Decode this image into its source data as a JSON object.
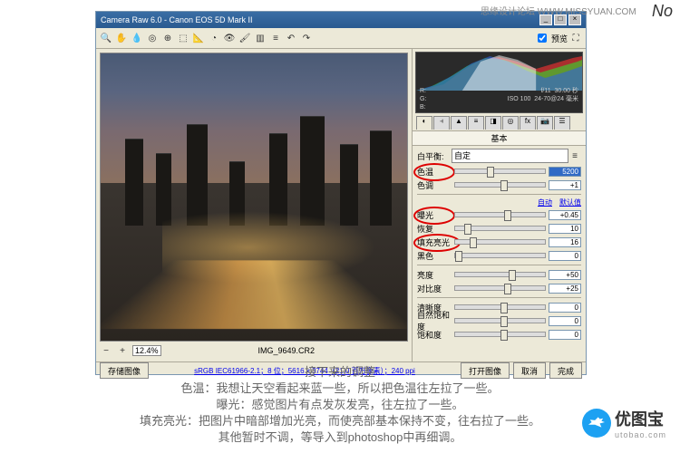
{
  "watermark": "思缘设计论坛  WWW.MISSYUAN.COM",
  "monogram": "No",
  "window": {
    "title": "Camera Raw 6.0  -  Canon EOS 5D Mark II"
  },
  "toolbar": {
    "preview_label": "预览"
  },
  "histogram": {
    "r": "R:",
    "g": "G:",
    "b": "B:",
    "aperture": "f/11",
    "shutter": "30.00 秒",
    "iso": "ISO 100",
    "lens": "24-70@24 毫米"
  },
  "tab_label": "基本",
  "wb": {
    "label": "白平衡:",
    "value": "自定"
  },
  "sliders": {
    "temp": {
      "label": "色温",
      "value": "5200"
    },
    "tint": {
      "label": "色调",
      "value": "+1"
    },
    "exposure": {
      "label": "曝光",
      "value": "+0.45"
    },
    "recovery": {
      "label": "恢复",
      "value": "10"
    },
    "fill": {
      "label": "填充亮光",
      "value": "16"
    },
    "black": {
      "label": "黑色",
      "value": "0"
    },
    "brightness": {
      "label": "亮度",
      "value": "+50"
    },
    "contrast": {
      "label": "对比度",
      "value": "+25"
    },
    "clarity": {
      "label": "清晰度",
      "value": "0"
    },
    "vibrance": {
      "label": "自然饱和度",
      "value": "0"
    },
    "saturation": {
      "label": "饱和度",
      "value": "0"
    }
  },
  "links": {
    "auto": "自动",
    "default": "默认值"
  },
  "zoom": {
    "value": "12.4%"
  },
  "filename": "IMG_9649.CR2",
  "meta": "sRGB IEC61966-2.1；8 位；5616 x 3744（21.0 百万像素）；240 ppi",
  "buttons": {
    "save": "存储图像",
    "open": "打开图像",
    "cancel": "取消",
    "done": "完成"
  },
  "caption": {
    "l1": "接下来的调整",
    "l2": "色温：我想让天空看起来蓝一些，所以把色温往左拉了一些。",
    "l3": "曝光：感觉图片有点发灰发亮，往左拉了一些。",
    "l4": "填充亮光：把图片中暗部增加光亮，而使亮部基本保持不变，往右拉了一些。",
    "l5": "其他暂时不调，等导入到photoshop中再细调。"
  },
  "logo": {
    "name": "优图宝",
    "url": "utobao.com"
  }
}
